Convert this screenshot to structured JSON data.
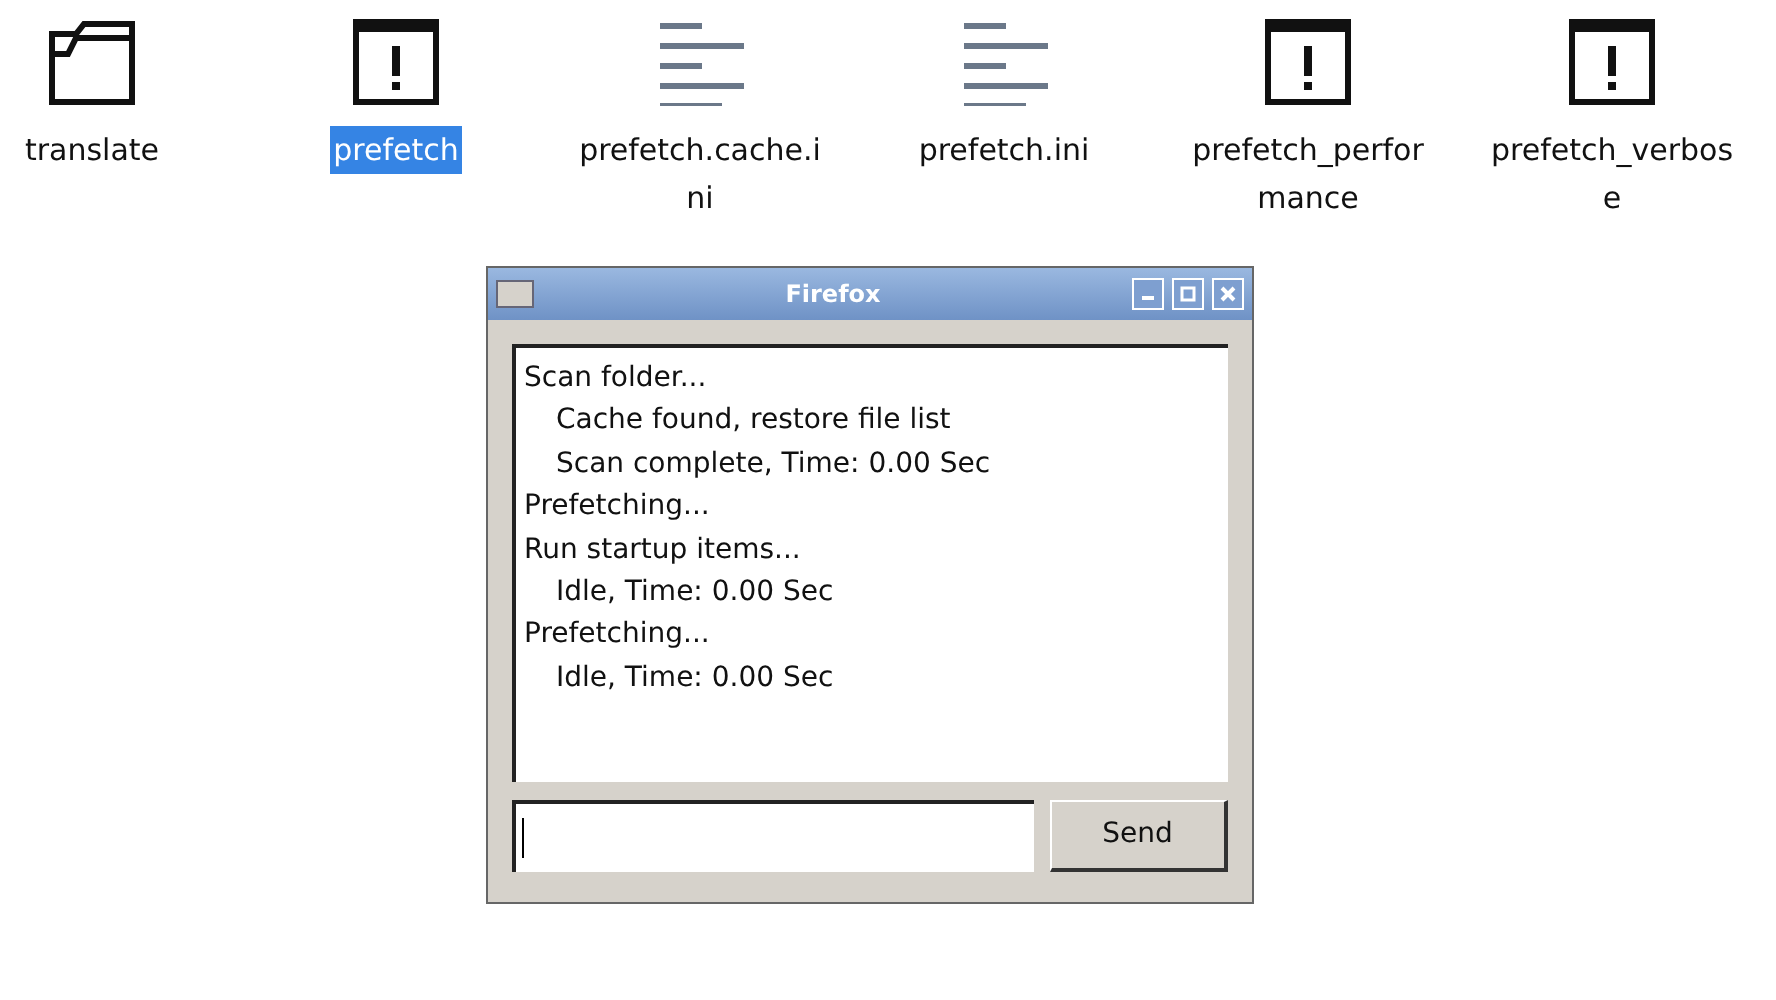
{
  "desktop_icons": [
    {
      "label": "translate",
      "kind": "folder",
      "selected": false
    },
    {
      "label": "prefetch",
      "kind": "executable",
      "selected": true
    },
    {
      "label": "prefetch.cache.ini",
      "kind": "text",
      "selected": false
    },
    {
      "label": "prefetch.ini",
      "kind": "text",
      "selected": false
    },
    {
      "label": "prefetch_performance",
      "kind": "executable",
      "selected": false
    },
    {
      "label": "prefetch_verbose",
      "kind": "executable",
      "selected": false
    }
  ],
  "window": {
    "title": "Firefox",
    "log": [
      {
        "text": "Scan folder...",
        "indented": false
      },
      {
        "text": "Cache found, restore file list",
        "indented": true
      },
      {
        "text": "Scan complete, Time: 0.00 Sec",
        "indented": true
      },
      {
        "text": "Prefetching...",
        "indented": false
      },
      {
        "text": "Run startup items...",
        "indented": false
      },
      {
        "text": "Idle, Time: 0.00 Sec",
        "indented": true
      },
      {
        "text": "Prefetching...",
        "indented": false
      },
      {
        "text": "Idle, Time: 0.00 Sec",
        "indented": true
      }
    ],
    "send_button": "Send"
  }
}
